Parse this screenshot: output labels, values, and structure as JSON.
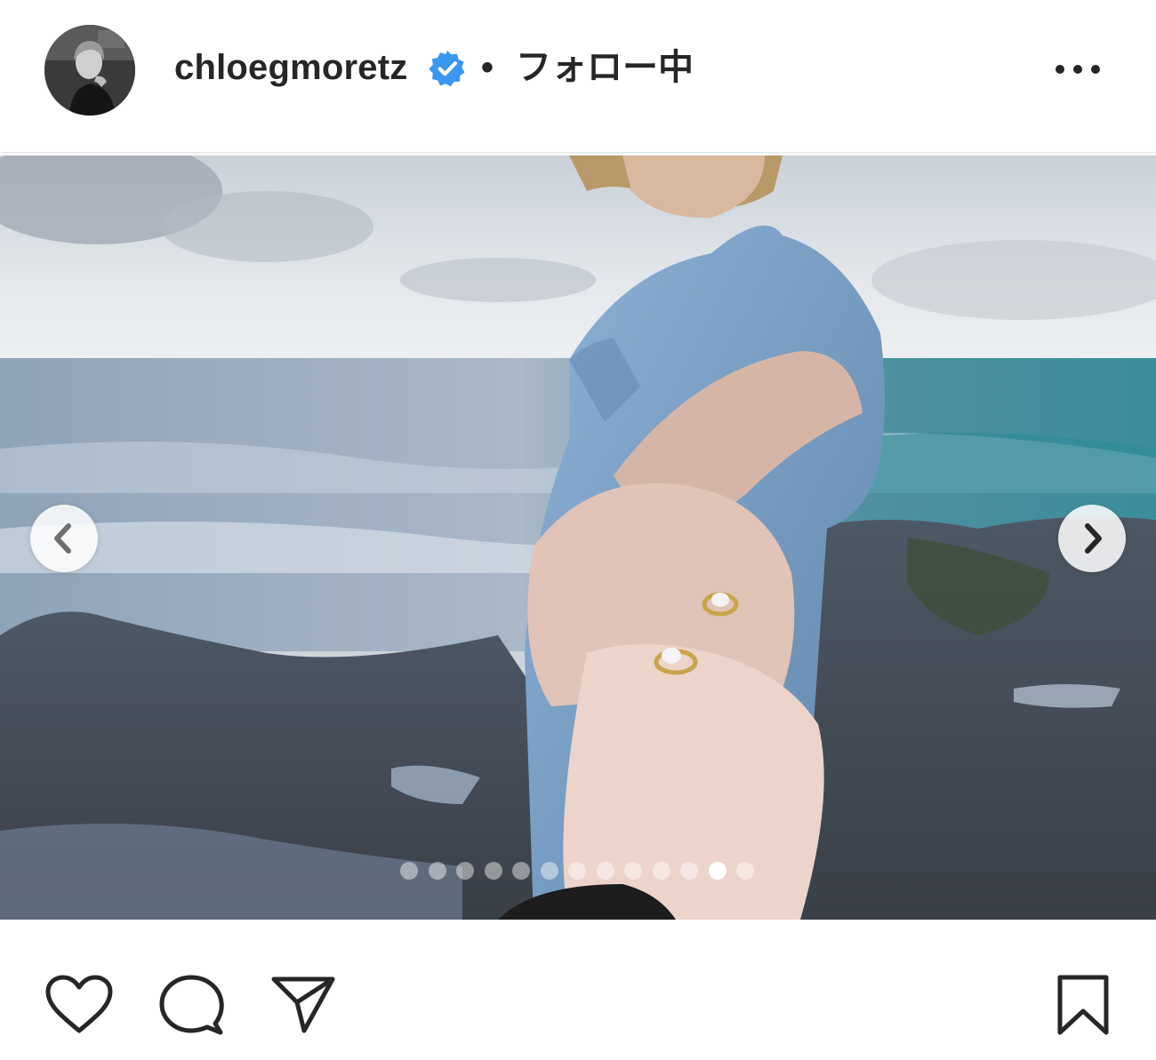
{
  "header": {
    "username": "chloegmoretz",
    "verified_icon": "verified-badge-icon",
    "separator": "•",
    "follow_status": "フォロー中",
    "more_icon": "more-options-icon"
  },
  "carousel": {
    "current_index": 12,
    "total": 13,
    "prev_icon": "chevron-left-icon",
    "next_icon": "chevron-right-icon",
    "photo_description_visible_text": ""
  },
  "actions": {
    "like_icon": "heart-icon",
    "comment_icon": "comment-icon",
    "share_icon": "send-icon",
    "save_icon": "bookmark-icon"
  },
  "colors": {
    "verified_blue": "#3897f0",
    "text": "#262626"
  }
}
